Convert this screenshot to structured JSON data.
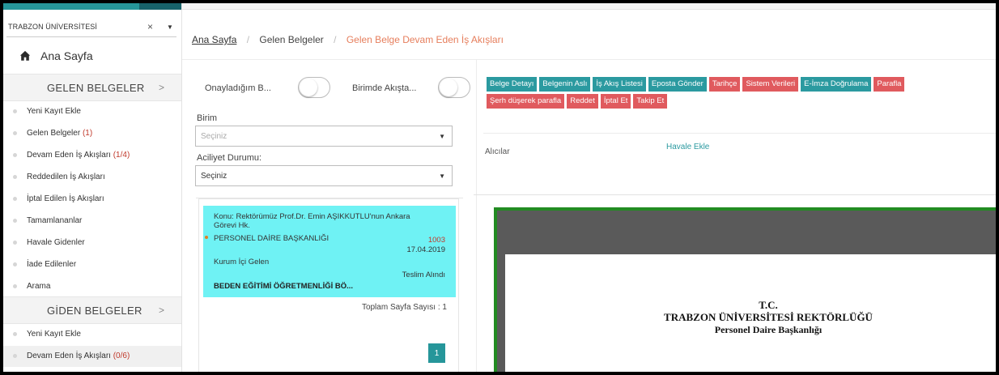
{
  "sidebar": {
    "unit_select": {
      "value": "TRABZON ÜNİVERSİTESİ",
      "clear": "×",
      "arrow": "▼"
    },
    "home_label": "Ana Sayfa",
    "sections": [
      {
        "title": "GELEN BELGELER",
        "chevron": ">",
        "items": [
          {
            "label": "Yeni Kayıt Ekle",
            "count": ""
          },
          {
            "label": "Gelen Belgeler",
            "count": "(1)"
          },
          {
            "label": "Devam Eden İş Akışları",
            "count": "(1/4)"
          },
          {
            "label": "Reddedilen İş Akışları",
            "count": ""
          },
          {
            "label": "İptal Edilen İş Akışları",
            "count": ""
          },
          {
            "label": "Tamamlananlar",
            "count": ""
          },
          {
            "label": "Havale Gidenler",
            "count": ""
          },
          {
            "label": "İade Edilenler",
            "count": ""
          },
          {
            "label": "Arama",
            "count": ""
          }
        ]
      },
      {
        "title": "GİDEN BELGELER",
        "chevron": ">",
        "items": [
          {
            "label": "Yeni Kayıt Ekle",
            "count": ""
          },
          {
            "label": "Devam Eden İş Akışları",
            "count": "(0/6)"
          }
        ]
      }
    ]
  },
  "breadcrumb": {
    "home": "Ana Sayfa",
    "sep": "/",
    "level2": "Gelen Belgeler",
    "current": "Gelen Belge Devam Eden İş Akışları"
  },
  "filters": {
    "toggle1_label": "Onayladığım B...",
    "toggle2_label": "Birimde Akışta...",
    "unit_label": "Birim",
    "unit_placeholder": "Seçiniz",
    "urgency_label": "Aciliyet Durumu:",
    "urgency_value": "Seçiniz",
    "arrow": "▼"
  },
  "document": {
    "subject": "Konu: Rektörümüz Prof.Dr. Emin AŞIKKUTLU'nun Ankara Görevi Hk.",
    "department": "PERSONEL DAİRE BAŞKANLIĞI",
    "number": "1003",
    "date": "17.04.2019",
    "type": "Kurum İçi Gelen",
    "status": "Teslim Alındı",
    "reference": "BEDEN EĞİTİMİ ÖĞRETMENLİĞİ BÖ..."
  },
  "pagination": {
    "total_label": "Toplam Sayfa Sayısı : 1",
    "current": "1"
  },
  "actions": {
    "row1": [
      {
        "label": "Belge Detayı",
        "style": "teal"
      },
      {
        "label": "Belgenin Aslı",
        "style": "teal"
      },
      {
        "label": "İş Akış Listesi",
        "style": "teal"
      },
      {
        "label": "Eposta Gönder",
        "style": "teal"
      },
      {
        "label": "Tarihçe",
        "style": "red"
      },
      {
        "label": "Sistem Verileri",
        "style": "red"
      },
      {
        "label": "E-İmza Doğrulama",
        "style": "teal"
      },
      {
        "label": "Parafla",
        "style": "red"
      }
    ],
    "row2": [
      {
        "label": "Şerh düşerek parafla",
        "style": "red"
      },
      {
        "label": "Reddet",
        "style": "red"
      },
      {
        "label": "İptal Et",
        "style": "red"
      },
      {
        "label": "Takip Et",
        "style": "red"
      }
    ]
  },
  "recipients": {
    "label": "Alıcılar",
    "add_link": "Havale Ekle"
  },
  "viewer": {
    "line1": "T.C.",
    "line2": "TRABZON ÜNİVERSİTESİ REKTÖRLÜĞÜ",
    "line3": "Personel Daire Başkanlığı"
  },
  "colors": {
    "teal": "#2b9aa0",
    "red": "#e05a5e",
    "card": "#6ff2f4",
    "viewer_border": "#228b22"
  }
}
